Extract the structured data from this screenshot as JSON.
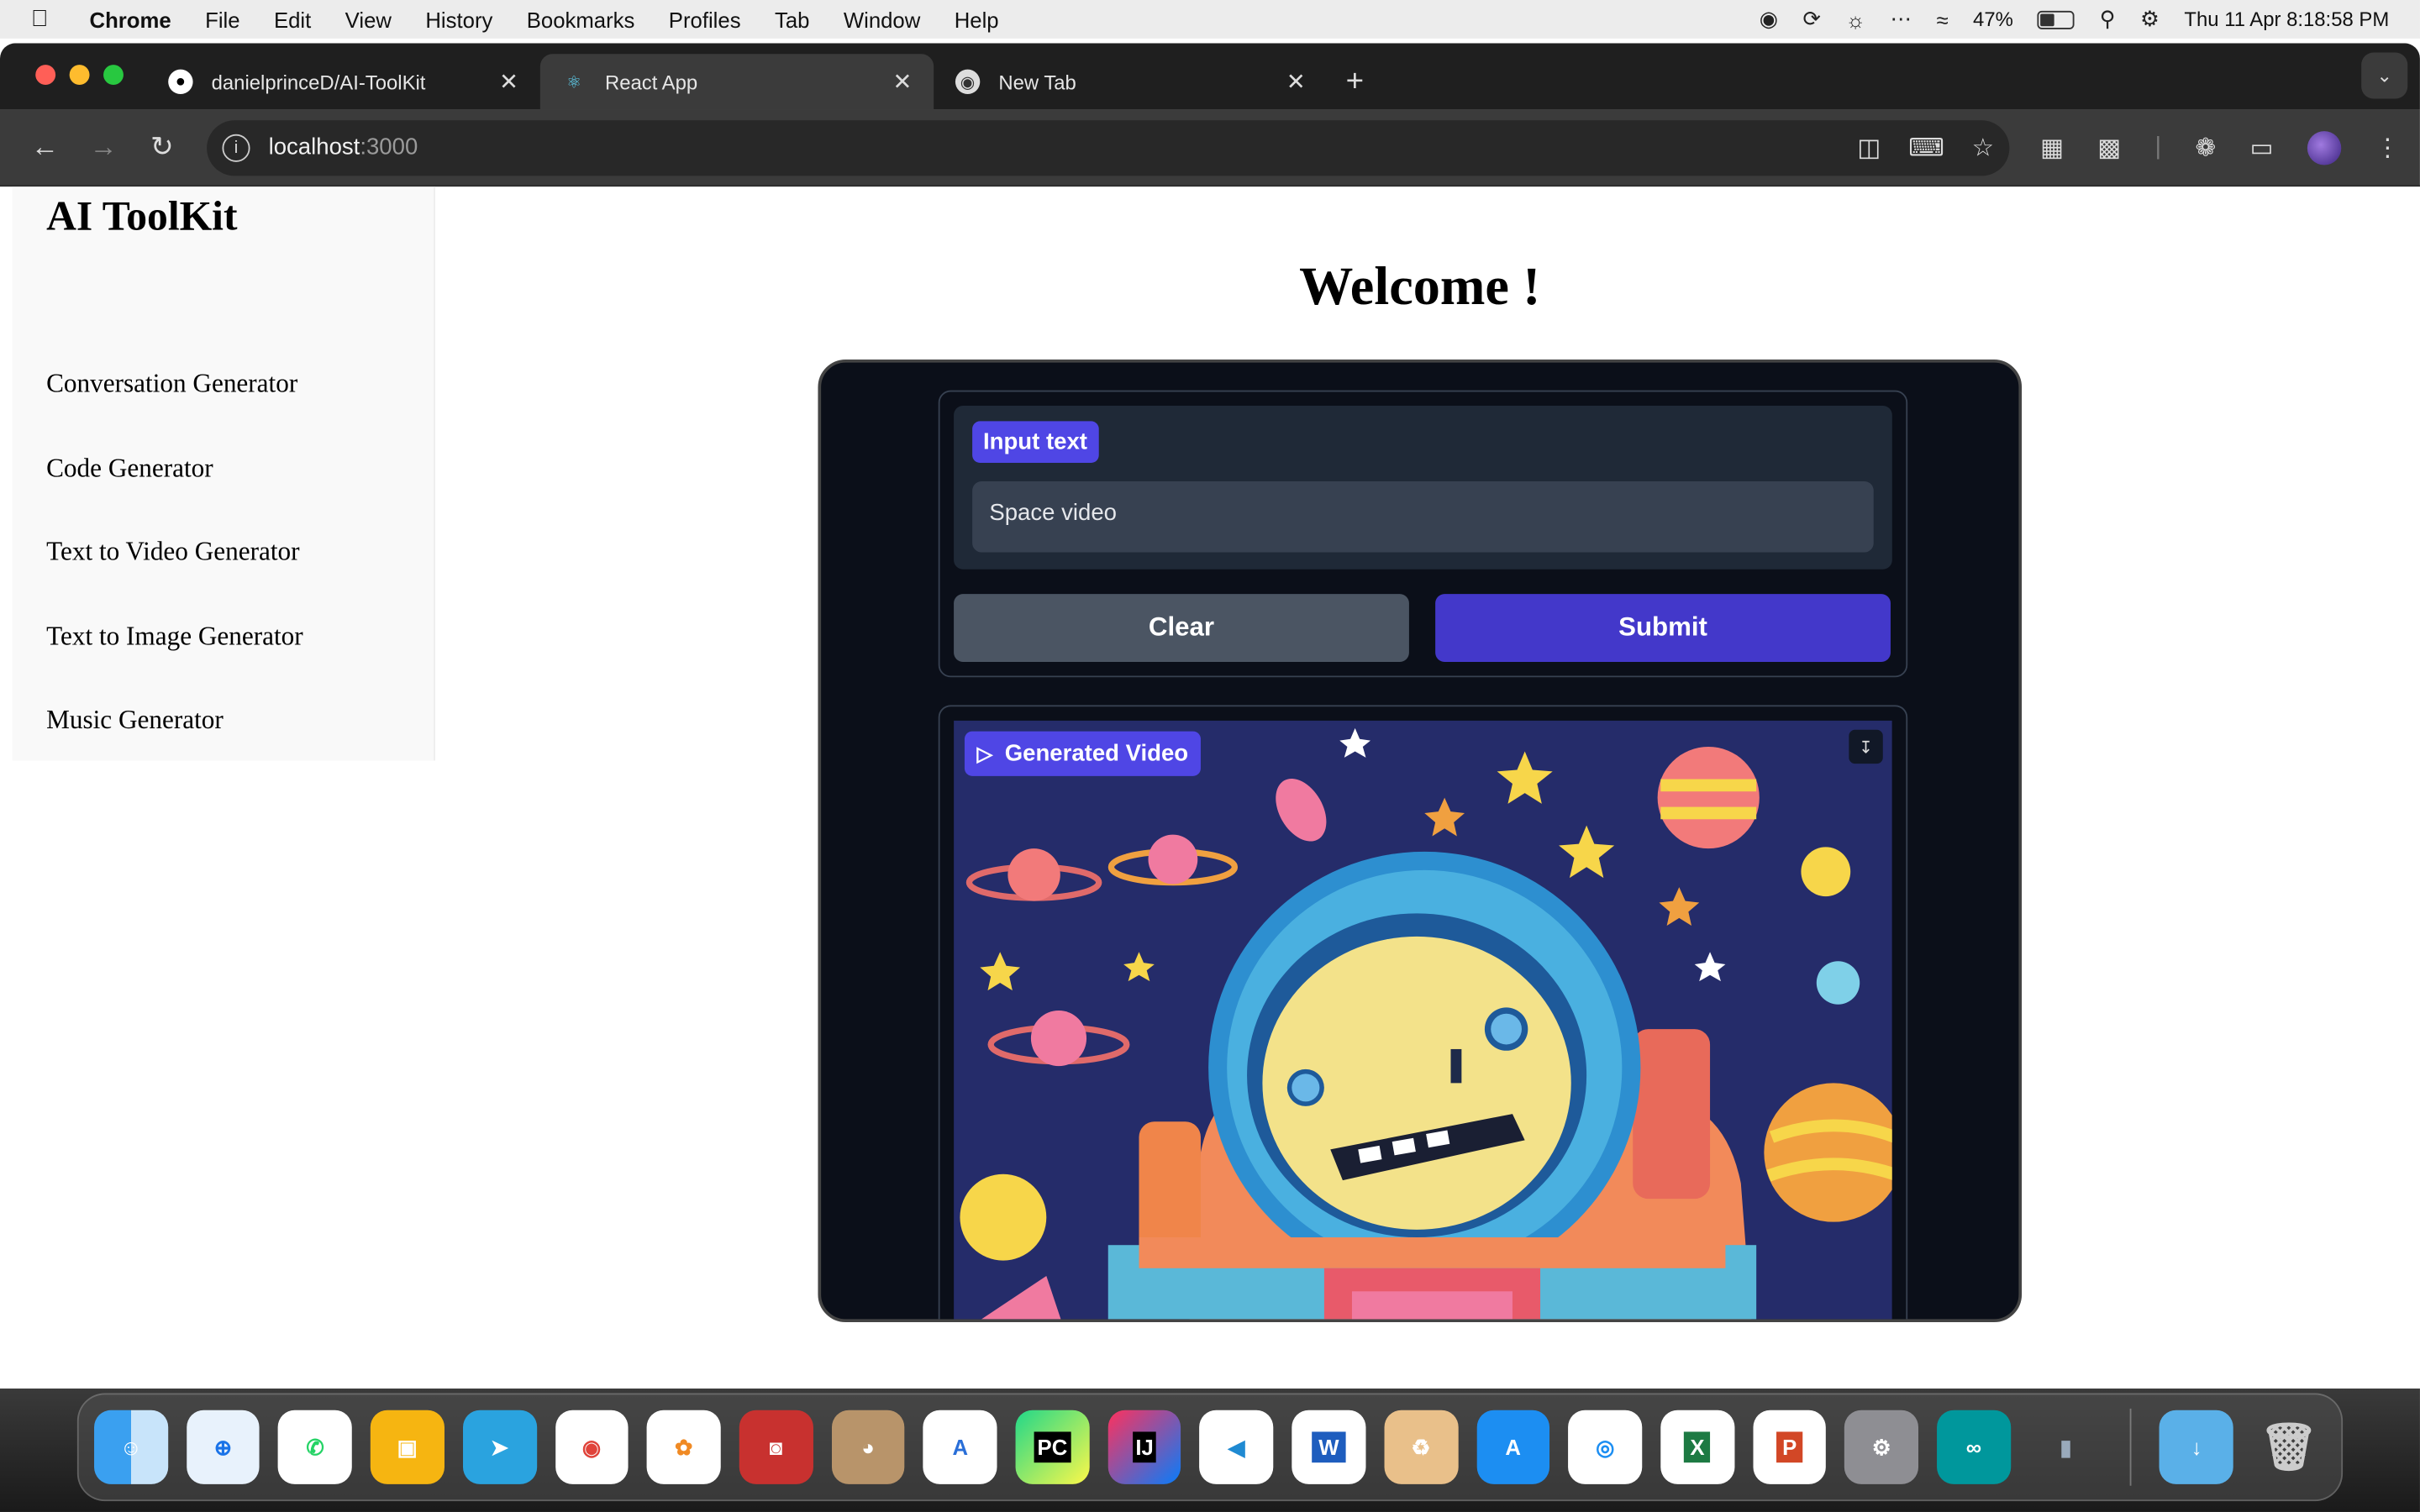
{
  "menubar": {
    "app_name": "Chrome",
    "items": [
      "File",
      "Edit",
      "View",
      "History",
      "Bookmarks",
      "Profiles",
      "Tab",
      "Window",
      "Help"
    ],
    "battery_percent": "47%",
    "battery_level": 0.47,
    "datetime": "Thu 11 Apr  8:18:58 PM"
  },
  "browser": {
    "tabs": [
      {
        "title": "danielprinceD/AI-ToolKit",
        "icon": "github-icon",
        "active": false
      },
      {
        "title": "React App",
        "icon": "react-icon",
        "active": true
      },
      {
        "title": "New Tab",
        "icon": "chrome-icon",
        "active": false
      }
    ],
    "url_host": "localhost",
    "url_port": ":3000"
  },
  "sidebar": {
    "brand": "AI ToolKit",
    "items": [
      {
        "label": "Conversation Generator"
      },
      {
        "label": "Code Generator"
      },
      {
        "label": "Text to Video Generator"
      },
      {
        "label": "Text to Image Generator"
      },
      {
        "label": "Music Generator"
      }
    ]
  },
  "main": {
    "heading": "Welcome !",
    "input_label": "Input text",
    "input_value": "Space video",
    "clear_label": "Clear",
    "submit_label": "Submit",
    "output_label": "Generated Video"
  },
  "colors": {
    "accent": "#4f46e5",
    "submit": "#4338ca",
    "clear": "#4b5563",
    "card_bg": "#0b0f19"
  },
  "dock": {
    "apps": [
      "finder-icon",
      "safari-icon",
      "whatsapp-icon",
      "classroom-icon",
      "telegram-icon",
      "chrome-icon",
      "photos-icon",
      "photo-booth-icon",
      "contacts-icon",
      "instruments-icon",
      "pycharm-icon",
      "intellij-icon",
      "vscode-icon",
      "word-icon",
      "recycle-icon",
      "app-store-icon",
      "airdrop-icon",
      "excel-icon",
      "powerpoint-icon",
      "system-settings-icon",
      "arduino-icon",
      "audio-meter-icon",
      "downloads-folder-icon",
      "trash-icon"
    ]
  }
}
